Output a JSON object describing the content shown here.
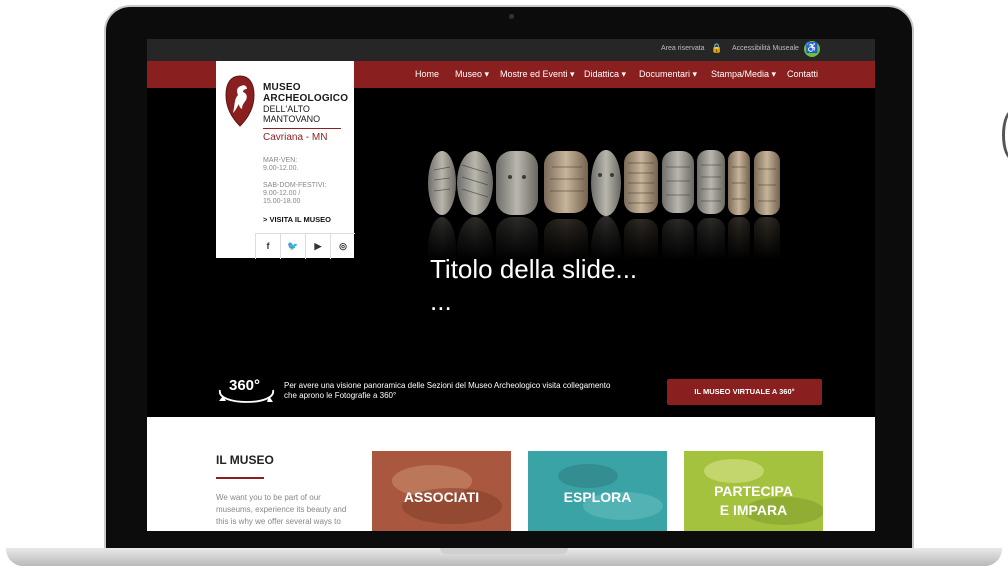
{
  "topbar": {
    "area_riservata": "Area riservata",
    "accessibilita": "Accessibilità Museale"
  },
  "nav": {
    "items": [
      {
        "label": "Home"
      },
      {
        "label": "Museo"
      },
      {
        "label": "Mostre ed Eventi"
      },
      {
        "label": "Didattica"
      },
      {
        "label": "Documentari"
      },
      {
        "label": "Stampa/Media"
      },
      {
        "label": "Contatti"
      }
    ],
    "caret": "▾"
  },
  "logo": {
    "title_line1": "MUSEO",
    "title_line2": "ARCHEOLOGICO",
    "sub_line1": "DELL'ALTO",
    "sub_line2": "MANTOVANO",
    "city": "Cavriana - MN",
    "hours1_label": "MAR-VEN:",
    "hours1_value": "9.00-12.00.",
    "hours2_label": "SAB-DOM-FESTIVI:",
    "hours2_value1": "9.00-12.00 /",
    "hours2_value2": "15.00-18.00",
    "visit_link": "> VISITA IL MUSEO"
  },
  "social": [
    {
      "icon": "facebook-icon",
      "glyph": "f"
    },
    {
      "icon": "twitter-icon",
      "glyph": "🐦"
    },
    {
      "icon": "youtube-icon",
      "glyph": "▶"
    },
    {
      "icon": "instagram-icon",
      "glyph": "◎"
    }
  ],
  "slide": {
    "title": "Titolo della slide...",
    "subtitle": "..."
  },
  "panorama": {
    "badge": "360°",
    "text_line1": "Per avere una visione panoramica delle Sezioni del Museo Archeologico  visita collegamento",
    "text_line2": "che aprono le Fotografie a 360°",
    "button": "IL MUSEO VIRTUALE A 360°"
  },
  "il_museo": {
    "title": "IL MUSEO",
    "text": "We want you to be part of our museums, experience its beauty and this is why we offer several ways to"
  },
  "tiles": [
    {
      "line1": "ASSOCIATI",
      "line2": "",
      "color": "#a9583f"
    },
    {
      "line1": "ESPLORA",
      "line2": "",
      "color": "#3aa3a6"
    },
    {
      "line1": "PARTECIPA",
      "line2": "E IMPARA",
      "color": "#a5c23e"
    }
  ],
  "colors": {
    "brand": "#8a1f1f",
    "accessibility": "#6fbf3a"
  }
}
